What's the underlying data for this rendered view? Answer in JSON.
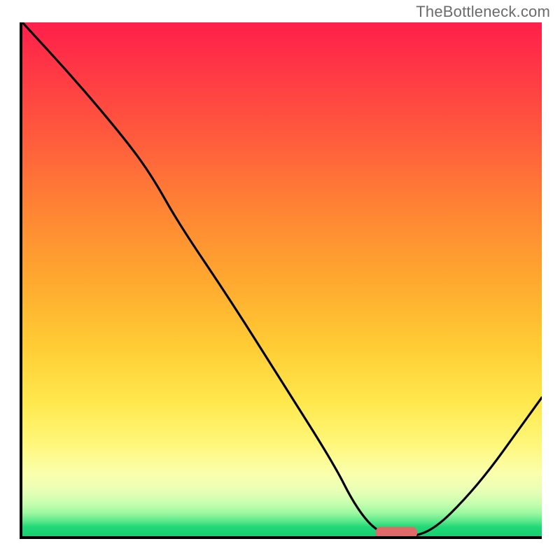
{
  "watermark": "TheBottleneck.com",
  "chart_data": {
    "type": "line",
    "title": "",
    "xlabel": "",
    "ylabel": "",
    "xlim": [
      0,
      100
    ],
    "ylim": [
      0,
      100
    ],
    "grid": false,
    "legend": false,
    "background_gradient": {
      "direction": "vertical",
      "stops": [
        {
          "pos": 0.0,
          "color": "#ff1f4b"
        },
        {
          "pos": 0.22,
          "color": "#ff5a3d"
        },
        {
          "pos": 0.5,
          "color": "#ffa82f"
        },
        {
          "pos": 0.74,
          "color": "#ffe84d"
        },
        {
          "pos": 0.88,
          "color": "#faffae"
        },
        {
          "pos": 0.95,
          "color": "#9cf8a0"
        },
        {
          "pos": 1.0,
          "color": "#16cf70"
        }
      ]
    },
    "series": [
      {
        "name": "curve",
        "color": "#000000",
        "x": [
          0.0,
          10,
          20,
          25,
          30,
          40,
          50,
          60,
          64,
          68,
          72,
          76,
          80,
          85,
          90,
          95,
          100
        ],
        "y": [
          100,
          89,
          77,
          70,
          61,
          46,
          30,
          14,
          6,
          1,
          0,
          0,
          2,
          7,
          13,
          20,
          27
        ]
      }
    ],
    "marker": {
      "name": "optimal-marker",
      "shape": "rounded-rect",
      "color": "#e06a6a",
      "x_range": [
        68,
        76
      ],
      "y": 0.7,
      "height": 2.2
    }
  }
}
